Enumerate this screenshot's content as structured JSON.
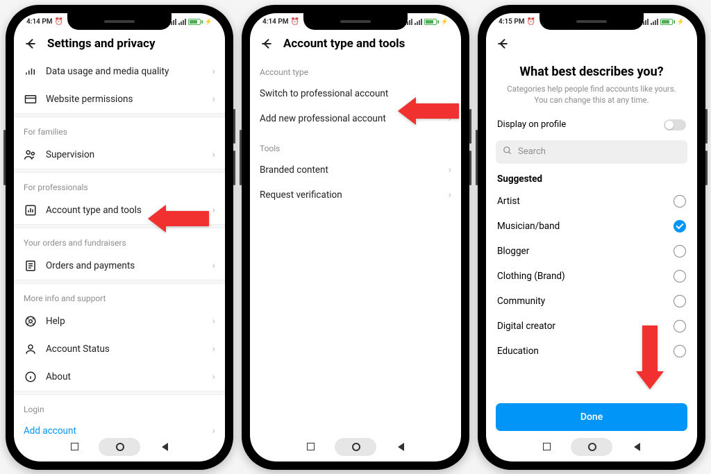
{
  "status": {
    "time1": "4:14 PM",
    "time2": "4:14 PM",
    "time3": "4:15 PM"
  },
  "screen1": {
    "title": "Settings and privacy",
    "items_top": [
      {
        "icon": "bars-icon",
        "label": "Data usage and media quality"
      },
      {
        "icon": "browser-icon",
        "label": "Website permissions"
      }
    ],
    "sec_families": "For families",
    "supervision": "Supervision",
    "sec_professionals": "For professionals",
    "account_tools": "Account type and tools",
    "sec_orders": "Your orders and fundraisers",
    "orders_payments": "Orders and payments",
    "sec_more": "More info and support",
    "help": "Help",
    "account_status": "Account Status",
    "about": "About",
    "sec_login": "Login",
    "add_account": "Add account"
  },
  "screen2": {
    "title": "Account type and tools",
    "sec_account_type": "Account type",
    "switch_pro": "Switch to professional account",
    "add_pro": "Add new professional account",
    "sec_tools": "Tools",
    "branded": "Branded content",
    "verify": "Request verification"
  },
  "screen3": {
    "heading": "What best describes you?",
    "subheading": "Categories help people find accounts like yours. You can change this at any time.",
    "display_on_profile": "Display on profile",
    "search_placeholder": "Search",
    "suggested": "Suggested",
    "categories": [
      {
        "label": "Artist",
        "selected": false
      },
      {
        "label": "Musician/band",
        "selected": true
      },
      {
        "label": "Blogger",
        "selected": false
      },
      {
        "label": "Clothing (Brand)",
        "selected": false
      },
      {
        "label": "Community",
        "selected": false
      },
      {
        "label": "Digital creator",
        "selected": false
      },
      {
        "label": "Education",
        "selected": false
      }
    ],
    "done": "Done"
  }
}
